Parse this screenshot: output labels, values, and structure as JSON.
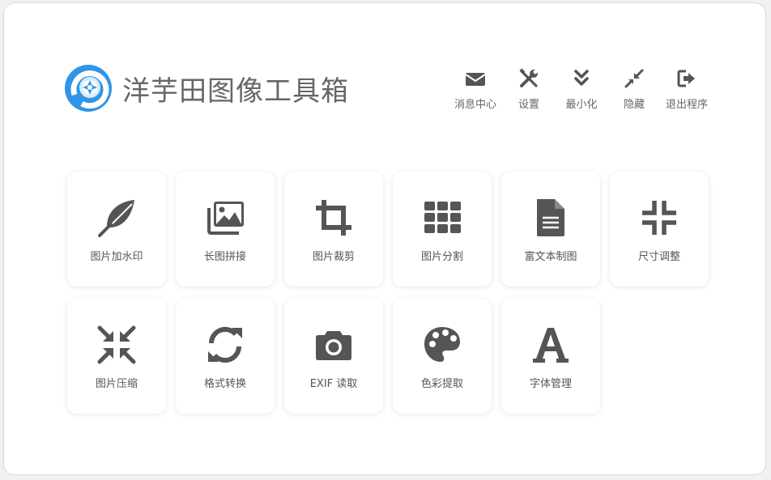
{
  "app": {
    "title": "洋芋田图像工具箱"
  },
  "toolbar": [
    {
      "label": "消息中心",
      "icon": "envelope-icon"
    },
    {
      "label": "设置",
      "icon": "tools-icon"
    },
    {
      "label": "最小化",
      "icon": "double-chevron-down-icon"
    },
    {
      "label": "隐藏",
      "icon": "compress-arrows-icon"
    },
    {
      "label": "退出程序",
      "icon": "sign-out-icon"
    }
  ],
  "tiles": [
    {
      "label": "图片加水印",
      "icon": "feather-icon"
    },
    {
      "label": "长图拼接",
      "icon": "images-icon"
    },
    {
      "label": "图片裁剪",
      "icon": "crop-icon"
    },
    {
      "label": "图片分割",
      "icon": "grid-icon"
    },
    {
      "label": "富文本制图",
      "icon": "document-icon"
    },
    {
      "label": "尺寸调整",
      "icon": "compress-icon"
    },
    {
      "label": "图片压缩",
      "icon": "arrows-inward-icon"
    },
    {
      "label": "格式转换",
      "icon": "sync-icon"
    },
    {
      "label": "EXIF 读取",
      "icon": "camera-icon"
    },
    {
      "label": "色彩提取",
      "icon": "palette-icon"
    },
    {
      "label": "字体管理",
      "icon": "font-icon"
    }
  ],
  "colors": {
    "icon": "#555555",
    "logo_blue": "#2f95e8",
    "background": "#ffffff"
  }
}
